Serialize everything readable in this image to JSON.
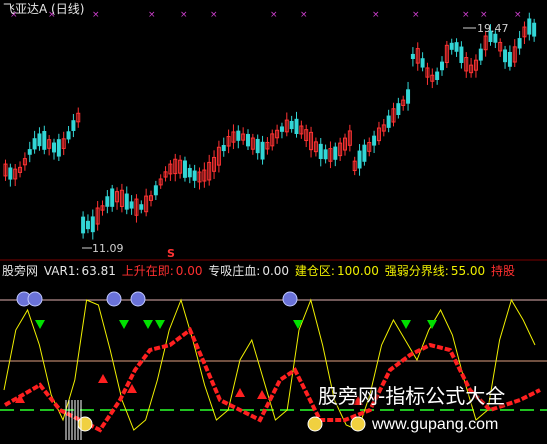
{
  "title": "飞亚达A (日线)",
  "price_chart": {
    "high_label": "19.47",
    "low_label": "11.09",
    "signal_marker": "S",
    "colors": {
      "up": "#ff3333",
      "down": "#33d6d6"
    }
  },
  "indicator_bar": {
    "source": "股旁网",
    "var1_label": "VAR1:",
    "var1_value": "63.81",
    "rise_label": "上升在即:",
    "rise_value": "0.00",
    "absorb_label": "专吸庄血:",
    "absorb_value": "0.00",
    "build_label": "建仓区:",
    "build_value": "100.00",
    "threshold_label": "强弱分界线:",
    "threshold_value": "55.00",
    "hold_label": "持股"
  },
  "watermark": {
    "text": "股旁网-指标公式大全",
    "url": "www.gupang.com"
  }
}
